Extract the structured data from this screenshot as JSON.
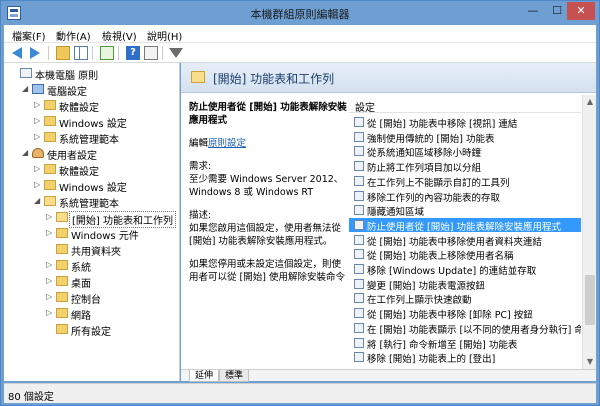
{
  "window": {
    "title": "本機群組原則編輯器"
  },
  "window_controls": {
    "minimize": "—",
    "maximize": "☐",
    "close": "✕"
  },
  "menu": [
    "檔案(F)",
    "動作(A)",
    "檢視(V)",
    "說明(H)"
  ],
  "toolbar": {
    "help_label": "?"
  },
  "tree": [
    {
      "label": "本機電腦 原則",
      "level": 0,
      "icon": "policy-icon",
      "expander": ""
    },
    {
      "label": "電腦設定",
      "level": 1,
      "icon": "computer-icon",
      "expander": "◢"
    },
    {
      "label": "軟體設定",
      "level": 2,
      "icon": "folder-icon",
      "expander": "▷"
    },
    {
      "label": "Windows 設定",
      "level": 2,
      "icon": "folder-icon",
      "expander": "▷"
    },
    {
      "label": "系統管理範本",
      "level": 2,
      "icon": "folder-icon",
      "expander": "▷"
    },
    {
      "label": "使用者設定",
      "level": 1,
      "icon": "user-icon",
      "expander": "◢"
    },
    {
      "label": "軟體設定",
      "level": 2,
      "icon": "folder-icon",
      "expander": "▷"
    },
    {
      "label": "Windows 設定",
      "level": 2,
      "icon": "folder-icon",
      "expander": "▷"
    },
    {
      "label": "系統管理範本",
      "level": 2,
      "icon": "folder-open-icon",
      "expander": "◢"
    },
    {
      "label": "[開始] 功能表和工作列",
      "level": 3,
      "icon": "folder-open-icon",
      "expander": "▷",
      "selected": true
    },
    {
      "label": "Windows 元件",
      "level": 3,
      "icon": "folder-icon",
      "expander": "▷"
    },
    {
      "label": "共用資料夾",
      "level": 3,
      "icon": "folder-icon",
      "expander": ""
    },
    {
      "label": "系統",
      "level": 3,
      "icon": "folder-icon",
      "expander": "▷"
    },
    {
      "label": "桌面",
      "level": 3,
      "icon": "folder-icon",
      "expander": "▷"
    },
    {
      "label": "控制台",
      "level": 3,
      "icon": "folder-icon",
      "expander": "▷"
    },
    {
      "label": "網路",
      "level": 3,
      "icon": "folder-icon",
      "expander": "▷"
    },
    {
      "label": "所有設定",
      "level": 3,
      "icon": "folder-icon",
      "expander": ""
    }
  ],
  "content": {
    "header_title": "[開始] 功能表和工作列",
    "policy_title": "防止使用者從 [開始] 功能表解除安裝應用程式",
    "edit_prefix": "編輯",
    "edit_link": "原則設定",
    "requirements_label": "需求:",
    "requirements_text": "至少需要 Windows Server 2012、Windows 8 或 Windows RT",
    "description_label": "描述:",
    "description_text": "如果您啟用這個設定，使用者無法從 [開始] 功能表解除安裝應用程式。",
    "description_text2": "如果您停用或未設定這個設定，則使用者可以從 [開始] 使用解除安裝命令",
    "list_header": "設定",
    "list_items": [
      "從 [開始] 功能表中移除 [視訊] 連結",
      "強制使用傳統的 [開始] 功能表",
      "從系統通知區域移除小時鐘",
      "防止將工作列項目加以分組",
      "在工作列上不能顯示自訂的工具列",
      "移除工作列的內容功能表的存取",
      "隱藏通知區域",
      "防止使用者從 [開始] 功能表解除安裝應用程式",
      "從 [開始] 功能表中移除使用者資料夾連結",
      "從 [開始] 功能表上移除使用者名稱",
      "移除 [Windows Update] 的連結並存取",
      "變更 [開始] 功能表電源按鈕",
      "在工作列上顯示快速啟動",
      "從 [開始] 功能表中移除 [卸除 PC] 按鈕",
      "在 [開始] 功能表顯示 [以不同的使用者身分執行] 命令",
      "將 [執行] 命令新增至 [開始] 功能表",
      "移除 [開始] 功能表上的 [登出]"
    ],
    "selected_index": 7
  },
  "tabs": [
    "延伸",
    "標準"
  ],
  "status": {
    "text": "80 個設定"
  }
}
